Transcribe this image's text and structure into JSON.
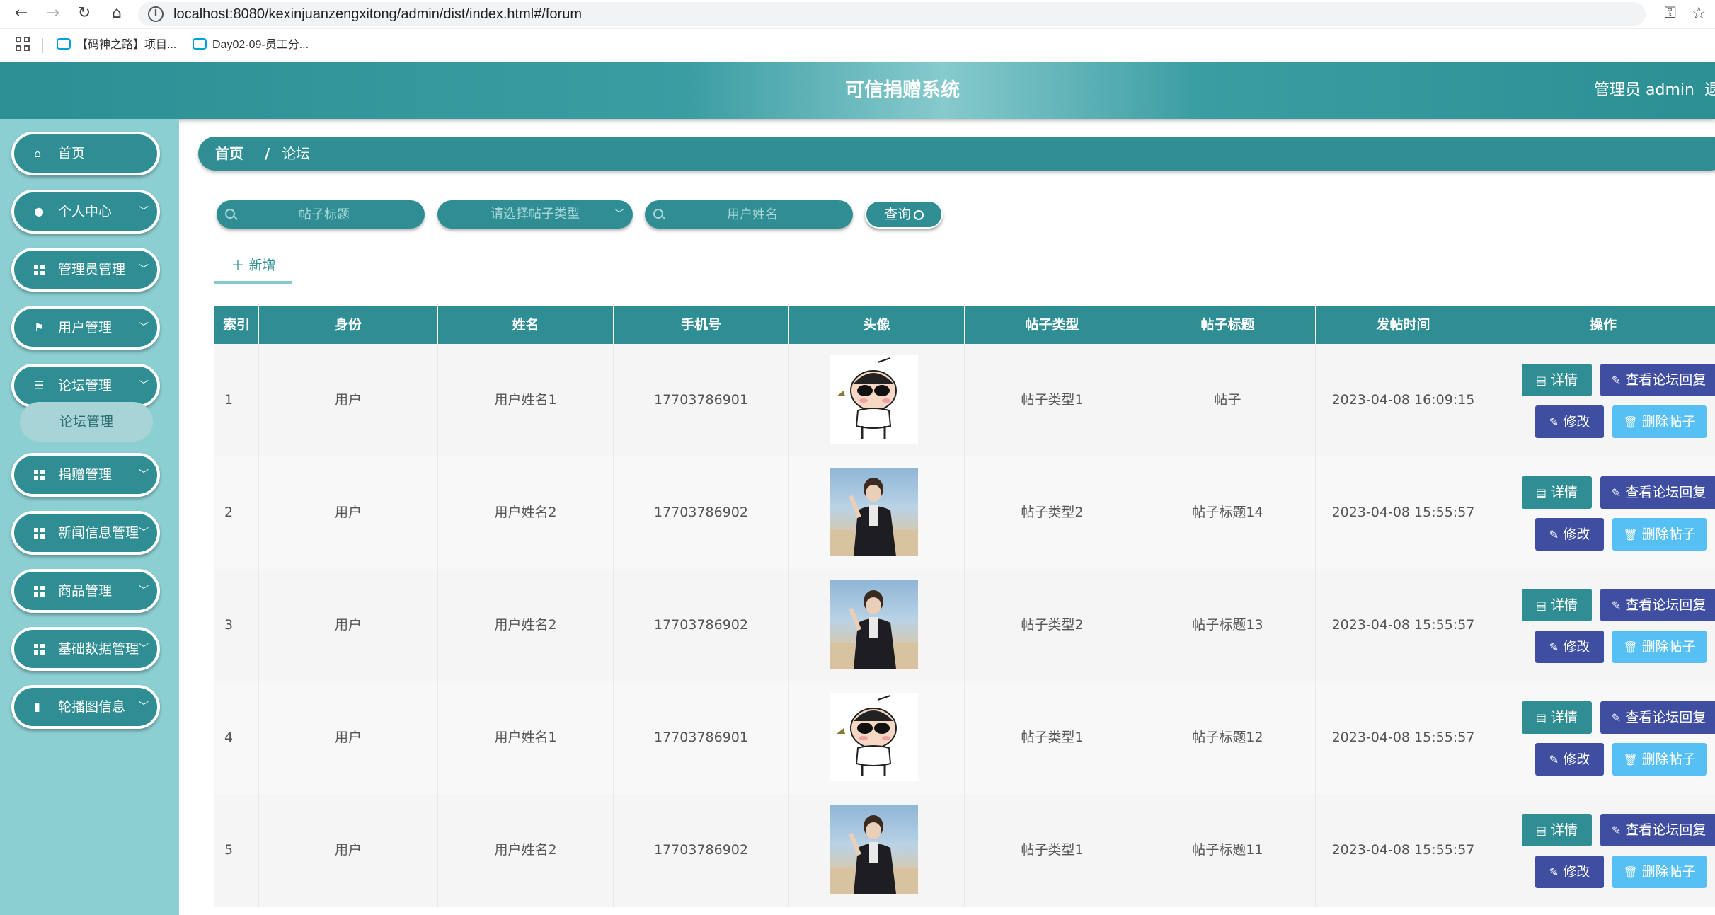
{
  "browser": {
    "url": "localhost:8080/kexinjuanzengxitong/admin/dist/index.html#/forum",
    "bookmarks": [
      {
        "label": "【码神之路】项目..."
      },
      {
        "label": "Day02-09-员工分..."
      }
    ]
  },
  "header": {
    "title": "可信捐赠系统",
    "admin": "管理员 admin",
    "logout": "退"
  },
  "sidebar": {
    "items": [
      {
        "label": "首页",
        "icon": "home-icon"
      },
      {
        "label": "个人中心",
        "icon": "user-icon"
      },
      {
        "label": "管理员管理",
        "icon": "grid-icon"
      },
      {
        "label": "用户管理",
        "icon": "flag-icon"
      },
      {
        "label": "论坛管理",
        "icon": "sliders-icon"
      },
      {
        "label": "捐赠管理",
        "icon": "grid-icon"
      },
      {
        "label": "新闻信息管理",
        "icon": "grid-icon"
      },
      {
        "label": "商品管理",
        "icon": "grid-icon"
      },
      {
        "label": "基础数据管理",
        "icon": "grid-icon"
      },
      {
        "label": "轮播图信息",
        "icon": "book-icon"
      }
    ],
    "submenu": {
      "label": "论坛管理"
    }
  },
  "breadcrumb": {
    "home": "首页",
    "separator": "/",
    "current": "论坛"
  },
  "search": {
    "title_placeholder": "帖子标题",
    "type_placeholder": "请选择帖子类型",
    "username_placeholder": "用户姓名",
    "query_label": "查询"
  },
  "actions": {
    "add_label": "新增"
  },
  "table": {
    "headers": [
      "索引",
      "身份",
      "姓名",
      "手机号",
      "头像",
      "帖子类型",
      "帖子标题",
      "发帖时间",
      "操作"
    ],
    "buttons": {
      "detail": "详情",
      "reply": "查看论坛回复",
      "edit": "修改",
      "delete": "删除帖子"
    },
    "rows": [
      {
        "index": "1",
        "role": "用户",
        "name": "用户姓名1",
        "phone": "17703786901",
        "avatar": "cartoon",
        "type": "帖子类型1",
        "title": "帖子",
        "time": "2023-04-08 16:09:15"
      },
      {
        "index": "2",
        "role": "用户",
        "name": "用户姓名2",
        "phone": "17703786902",
        "avatar": "photo",
        "type": "帖子类型2",
        "title": "帖子标题14",
        "time": "2023-04-08 15:55:57"
      },
      {
        "index": "3",
        "role": "用户",
        "name": "用户姓名2",
        "phone": "17703786902",
        "avatar": "photo",
        "type": "帖子类型2",
        "title": "帖子标题13",
        "time": "2023-04-08 15:55:57"
      },
      {
        "index": "4",
        "role": "用户",
        "name": "用户姓名1",
        "phone": "17703786901",
        "avatar": "cartoon",
        "type": "帖子类型1",
        "title": "帖子标题12",
        "time": "2023-04-08 15:55:57"
      },
      {
        "index": "5",
        "role": "用户",
        "name": "用户姓名2",
        "phone": "17703786902",
        "avatar": "photo",
        "type": "帖子类型1",
        "title": "帖子标题11",
        "time": "2023-04-08 15:55:57"
      }
    ]
  }
}
